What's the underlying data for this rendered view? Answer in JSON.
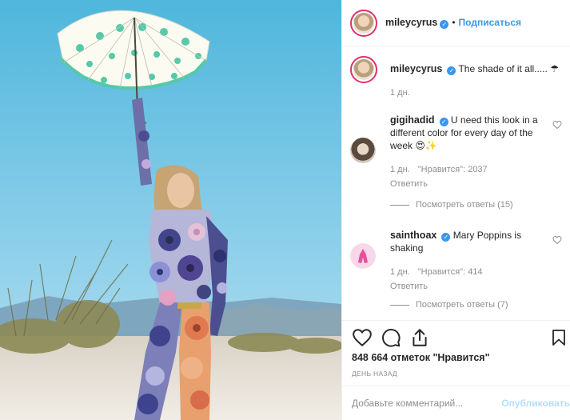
{
  "author": {
    "username": "mileycyrus",
    "verified_icon": "verified-badge-icon",
    "follow_label": "Подписаться",
    "separator": "•"
  },
  "caption": {
    "username": "mileycyrus",
    "text": "The shade of it all..... ☂",
    "time": "1 дн."
  },
  "comments": [
    {
      "username": "gigihadid",
      "text": "U need this look in a different color for every day of the week 😍✨",
      "time": "1 дн.",
      "likes": "\"Нравится\": 2037",
      "reply_label": "Ответить",
      "view_replies": "Посмотреть ответы (15)"
    },
    {
      "username": "sainthoax",
      "text": "Mary Poppins is shaking",
      "time": "1 дн.",
      "likes": "\"Нравится\": 414",
      "reply_label": "Ответить",
      "view_replies": "Посмотреть ответы (7)"
    }
  ],
  "likes_count": "848 664 отметок \"Нравится\"",
  "time_ago": "ДЕНЬ НАЗАД",
  "composer": {
    "placeholder": "Добавьте комментарий...",
    "publish_label": "Опубликовать"
  },
  "colors": {
    "link_blue": "#3897f0",
    "publish_disabled": "#b2dffc",
    "secondary_text": "#8e8e8e",
    "border": "#efefef"
  }
}
